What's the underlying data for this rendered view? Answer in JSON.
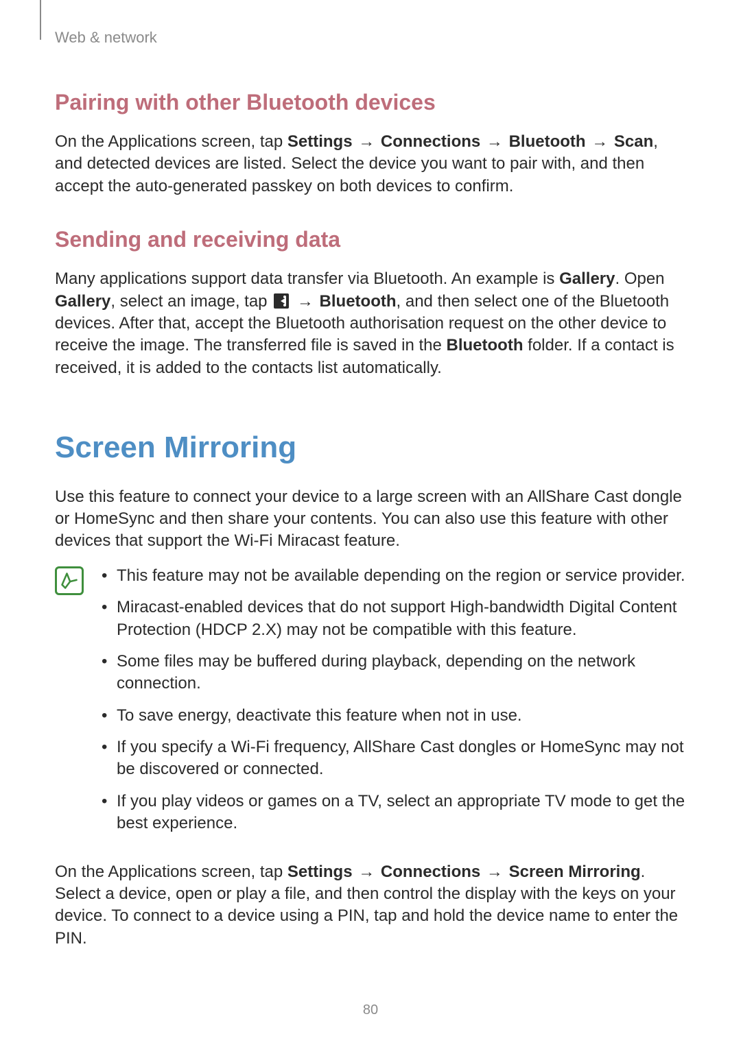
{
  "breadcrumb": "Web & network",
  "page_number": "80",
  "arrow": "→",
  "sect1": {
    "heading": "Pairing with other Bluetooth devices",
    "p_pre": "On the Applications screen, tap ",
    "b1": "Settings",
    "b2": "Connections",
    "b3": "Bluetooth",
    "b4": "Scan",
    "p_post": ", and detected devices are listed. Select the device you want to pair with, and then accept the auto-generated passkey on both devices to confirm."
  },
  "sect2": {
    "heading": "Sending and receiving data",
    "p1_pre": "Many applications support data transfer via Bluetooth. An example is ",
    "b_gallery": "Gallery",
    "p1_mid1": ". Open ",
    "p1_mid2": ", select an image, tap ",
    "b_bluetooth": "Bluetooth",
    "p1_mid3": ", and then select one of the Bluetooth devices. After that, accept the Bluetooth authorisation request on the other device to receive the image. The transferred file is saved in the ",
    "p1_post": " folder. If a contact is received, it is added to the contacts list automatically."
  },
  "title2": "Screen Mirroring",
  "sm_intro": "Use this feature to connect your device to a large screen with an AllShare Cast dongle or HomeSync and then share your contents. You can also use this feature with other devices that support the Wi-Fi Miracast feature.",
  "notes": [
    "This feature may not be available depending on the region or service provider.",
    "Miracast-enabled devices that do not support High-bandwidth Digital Content Protection (HDCP 2.X) may not be compatible with this feature.",
    "Some files may be buffered during playback, depending on the network connection.",
    "To save energy, deactivate this feature when not in use.",
    "If you specify a Wi-Fi frequency, AllShare Cast dongles or HomeSync may not be discovered or connected.",
    "If you play videos or games on a TV, select an appropriate TV mode to get the best experience."
  ],
  "sm_out": {
    "pre": "On the Applications screen, tap ",
    "b1": "Settings",
    "b2": "Connections",
    "b3": "Screen Mirroring",
    "post": ". Select a device, open or play a file, and then control the display with the keys on your device. To connect to a device using a PIN, tap and hold the device name to enter the PIN."
  }
}
